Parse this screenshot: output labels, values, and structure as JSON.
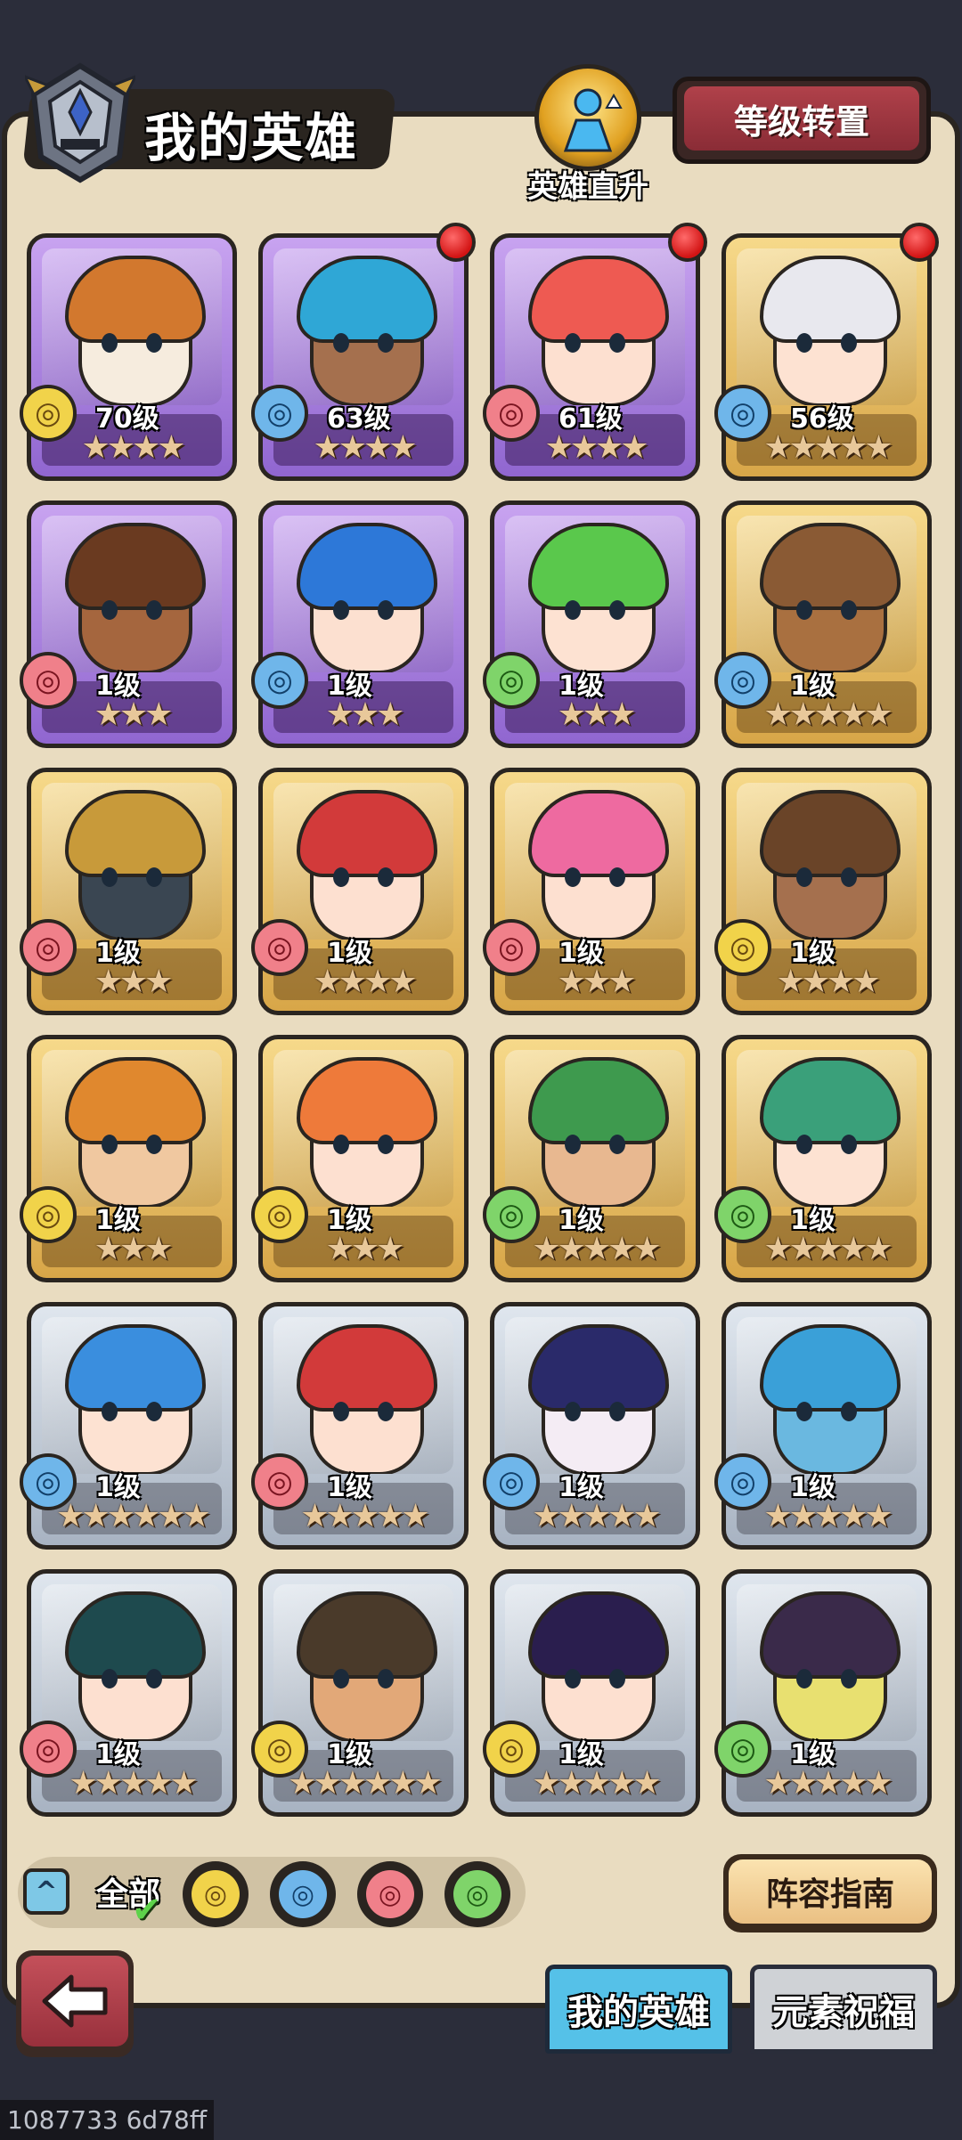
{
  "header": {
    "title": "我的英雄",
    "promote_label": "英雄直升",
    "level_transfer_label": "等级转置"
  },
  "heroes": [
    {
      "level": "70级",
      "stars": "★★★★",
      "element": "earth",
      "frame": "purple",
      "notif": false,
      "hair": "#d2782e",
      "skin": "#f6ecde"
    },
    {
      "level": "63级",
      "stars": "★★★★",
      "element": "water",
      "frame": "purple",
      "notif": true,
      "hair": "#2fa7d6",
      "skin": "#a5704e"
    },
    {
      "level": "61级",
      "stars": "★★★★",
      "element": "fire",
      "frame": "purple",
      "notif": true,
      "hair": "#ee5a52",
      "skin": "#fde0d0"
    },
    {
      "level": "56级",
      "stars": "★★★★★",
      "element": "water",
      "frame": "gold",
      "notif": true,
      "hair": "#e8e8ee",
      "skin": "#fde2d2"
    },
    {
      "level": "1级",
      "stars": "★★★",
      "element": "fire",
      "frame": "purple",
      "notif": false,
      "hair": "#6a3a20",
      "skin": "#a5663e"
    },
    {
      "level": "1级",
      "stars": "★★★",
      "element": "water",
      "frame": "purple",
      "notif": false,
      "hair": "#2d78d8",
      "skin": "#fce0d0"
    },
    {
      "level": "1级",
      "stars": "★★★",
      "element": "wind",
      "frame": "purple",
      "notif": false,
      "hair": "#5ac84c",
      "skin": "#fde2d2"
    },
    {
      "level": "1级",
      "stars": "★★★★★",
      "element": "water",
      "frame": "gold",
      "notif": false,
      "hair": "#8a5a34",
      "skin": "#a97040"
    },
    {
      "level": "1级",
      "stars": "★★★",
      "element": "fire",
      "frame": "gold",
      "notif": false,
      "hair": "#c89a3a",
      "skin": "#3a4652"
    },
    {
      "level": "1级",
      "stars": "★★★★",
      "element": "fire",
      "frame": "gold",
      "notif": false,
      "hair": "#d23a3a",
      "skin": "#fde0d0"
    },
    {
      "level": "1级",
      "stars": "★★★",
      "element": "fire",
      "frame": "gold",
      "notif": false,
      "hair": "#ee6aa0",
      "skin": "#fde0d0"
    },
    {
      "level": "1级",
      "stars": "★★★★",
      "element": "earth",
      "frame": "gold",
      "notif": false,
      "hair": "#6a4428",
      "skin": "#a5704e"
    },
    {
      "level": "1级",
      "stars": "★★★",
      "element": "earth",
      "frame": "gold",
      "notif": false,
      "hair": "#e0882e",
      "skin": "#f0c8a0"
    },
    {
      "level": "1级",
      "stars": "★★★",
      "element": "earth",
      "frame": "gold",
      "notif": false,
      "hair": "#ee7a3a",
      "skin": "#fde0d0"
    },
    {
      "level": "1级",
      "stars": "★★★★★",
      "element": "wind",
      "frame": "gold",
      "notif": false,
      "hair": "#3e9a4e",
      "skin": "#e8b890"
    },
    {
      "level": "1级",
      "stars": "★★★★★",
      "element": "wind",
      "frame": "gold",
      "notif": false,
      "hair": "#3aa07a",
      "skin": "#fde2d2"
    },
    {
      "level": "1级",
      "stars": "★★★★★★",
      "element": "water",
      "frame": "silver",
      "notif": false,
      "hair": "#3a8ede",
      "skin": "#fde2d2"
    },
    {
      "level": "1级",
      "stars": "★★★★★",
      "element": "fire",
      "frame": "silver",
      "notif": false,
      "hair": "#d23a3a",
      "skin": "#fde0d0"
    },
    {
      "level": "1级",
      "stars": "★★★★★",
      "element": "water",
      "frame": "silver",
      "notif": false,
      "hair": "#2a2a6a",
      "skin": "#f4ecf4"
    },
    {
      "level": "1级",
      "stars": "★★★★★",
      "element": "water",
      "frame": "silver",
      "notif": false,
      "hair": "#3aa0d8",
      "skin": "#6ab8e0"
    },
    {
      "level": "1级",
      "stars": "★★★★★",
      "element": "fire",
      "frame": "silver",
      "notif": false,
      "hair": "#1e4a4e",
      "skin": "#fde0d0"
    },
    {
      "level": "1级",
      "stars": "★★★★★★",
      "element": "earth",
      "frame": "silver",
      "notif": false,
      "hair": "#4a3a2a",
      "skin": "#e2a878"
    },
    {
      "level": "1级",
      "stars": "★★★★★",
      "element": "earth",
      "frame": "silver",
      "notif": false,
      "hair": "#2a1e4e",
      "skin": "#fde0d0"
    },
    {
      "level": "1级",
      "stars": "★★★★★",
      "element": "wind",
      "frame": "silver",
      "notif": false,
      "hair": "#3a2a4a",
      "skin": "#e8e070"
    }
  ],
  "filters": {
    "all_label": "全部",
    "collapse_icon": "chevron-up-icon",
    "element_order": [
      "earth",
      "water",
      "fire",
      "wind"
    ]
  },
  "buttons": {
    "guide_label": "阵容指南"
  },
  "tabs": {
    "my_heroes": "我的英雄",
    "element_blessing": "元素祝福"
  },
  "footer": {
    "id_text": "1087733 6d78ff"
  },
  "colors": {
    "panel_bg": "#e9dcc0",
    "outline": "#2a2520",
    "notification": "#d21414",
    "tab_active": "#55c1e8"
  }
}
